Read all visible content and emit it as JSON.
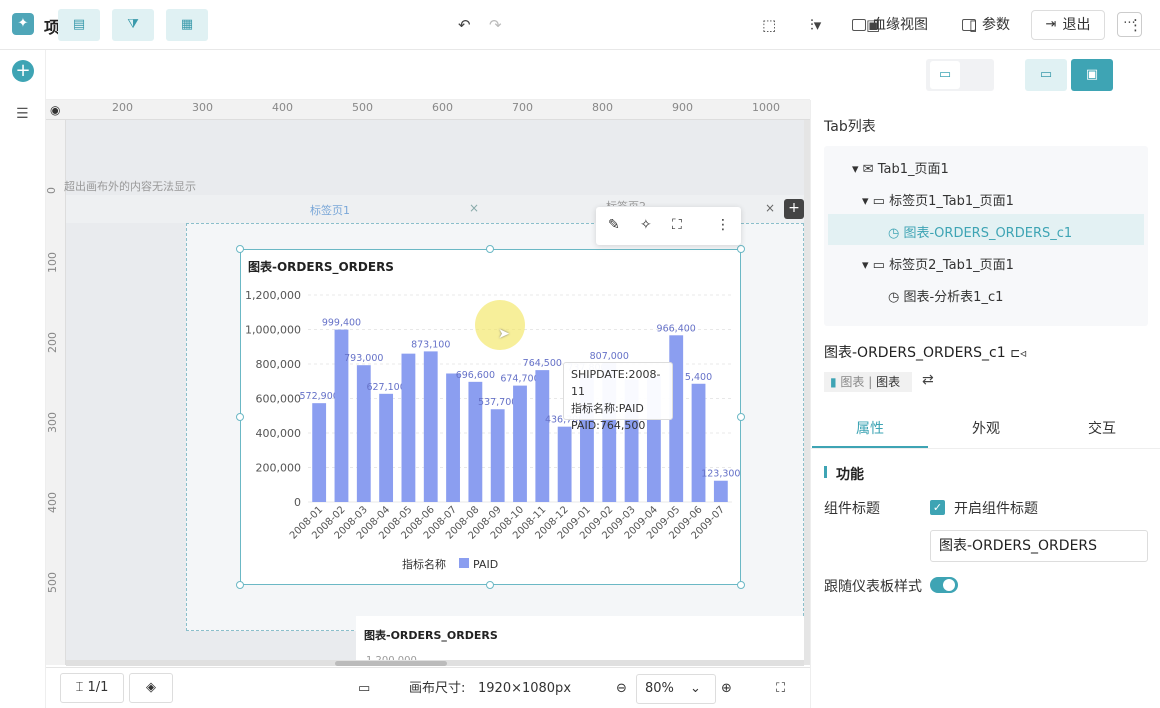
{
  "header": {
    "project_title": "项目2",
    "lineage_label": "血缘视图",
    "params_label": "参数",
    "exit_label": "退出",
    "more_icon": "···"
  },
  "ruler": {
    "h_ticks": [
      "200",
      "300",
      "400",
      "500",
      "600",
      "700",
      "800",
      "900",
      "1000"
    ],
    "v_ticks": [
      "0",
      "100",
      "200",
      "300",
      "400",
      "500"
    ]
  },
  "canvas": {
    "overflow_note": "超出画布外的内容无法显示",
    "tab1_label": "标签页1",
    "tab2_label": "标签页2",
    "tab_close": "×",
    "tab_add": "+"
  },
  "chart_widget": {
    "title": "图表-ORDERS_ORDERS",
    "legend_axis_label": "指标名称",
    "tooltip": {
      "line1": "SHIPDATE:2008-11",
      "line2": "指标名称:PAID",
      "line3": "PAID:764,500"
    }
  },
  "chart_data": {
    "type": "bar",
    "title": "图表-ORDERS_ORDERS",
    "categories": [
      "2008-01",
      "2008-02",
      "2008-03",
      "2008-04",
      "2008-05",
      "2008-06",
      "2008-07",
      "2008-08",
      "2008-09",
      "2008-10",
      "2008-11",
      "2008-12",
      "2009-01",
      "2009-02",
      "2009-03",
      "2009-04",
      "2009-05",
      "2009-06",
      "2009-07"
    ],
    "series": [
      {
        "name": "PAID",
        "values": [
          572900,
          999400,
          793000,
          627100,
          860000,
          873100,
          745000,
          696600,
          537700,
          674700,
          764500,
          436700,
          737800,
          807000,
          710000,
          730000,
          966400,
          685400,
          123300
        ]
      }
    ],
    "labels": [
      "572,900",
      "999,400",
      "793,000",
      "627,100",
      "",
      "873,100",
      "",
      "696,600",
      "537,700",
      "674,700",
      "764,500",
      "436,700",
      "737,800",
      "807,000",
      "",
      "",
      "966,400",
      "5,400",
      "123,300"
    ],
    "yticks": [
      "1,200,000",
      "1,000,000",
      "800,000",
      "600,000",
      "400,000",
      "200,000",
      "0"
    ],
    "ytick_values": [
      1200000,
      1000000,
      800000,
      600000,
      400000,
      200000,
      0
    ],
    "ylim": [
      0,
      1200000
    ],
    "legend_title": "指标名称",
    "legend_position": "bottom",
    "bar_color": "#8b9ef0"
  },
  "chart2": {
    "title": "图表-ORDERS_ORDERS",
    "first_tick": "1,200,000"
  },
  "bottom": {
    "page_label": "1/1",
    "canvas_size_label": "画布尺寸:",
    "canvas_size_value": "1920×1080px",
    "zoom_value": "80%"
  },
  "panel": {
    "tab_list_title": "Tab列表",
    "tree": [
      {
        "label": "Tab1_页面1"
      },
      {
        "label": "标签页1_Tab1_页面1"
      },
      {
        "label": "图表-ORDERS_ORDERS_c1"
      },
      {
        "label": "标签页2_Tab1_页面1"
      },
      {
        "label": "图表-分析表1_c1"
      }
    ],
    "component_name": "图表-ORDERS_ORDERS_c1",
    "component_type_a": "图表",
    "component_type_b": "图表",
    "tabs": [
      "属性",
      "外观",
      "交互"
    ],
    "section_title": "功能",
    "title_label": "组件标题",
    "title_checkbox_label": "开启组件标题",
    "title_input_value": "图表-ORDERS_ORDERS",
    "follow_label": "跟随仪表板样式"
  },
  "colors": {
    "accent": "#3ea4b4",
    "bar": "#8b9ef0"
  }
}
